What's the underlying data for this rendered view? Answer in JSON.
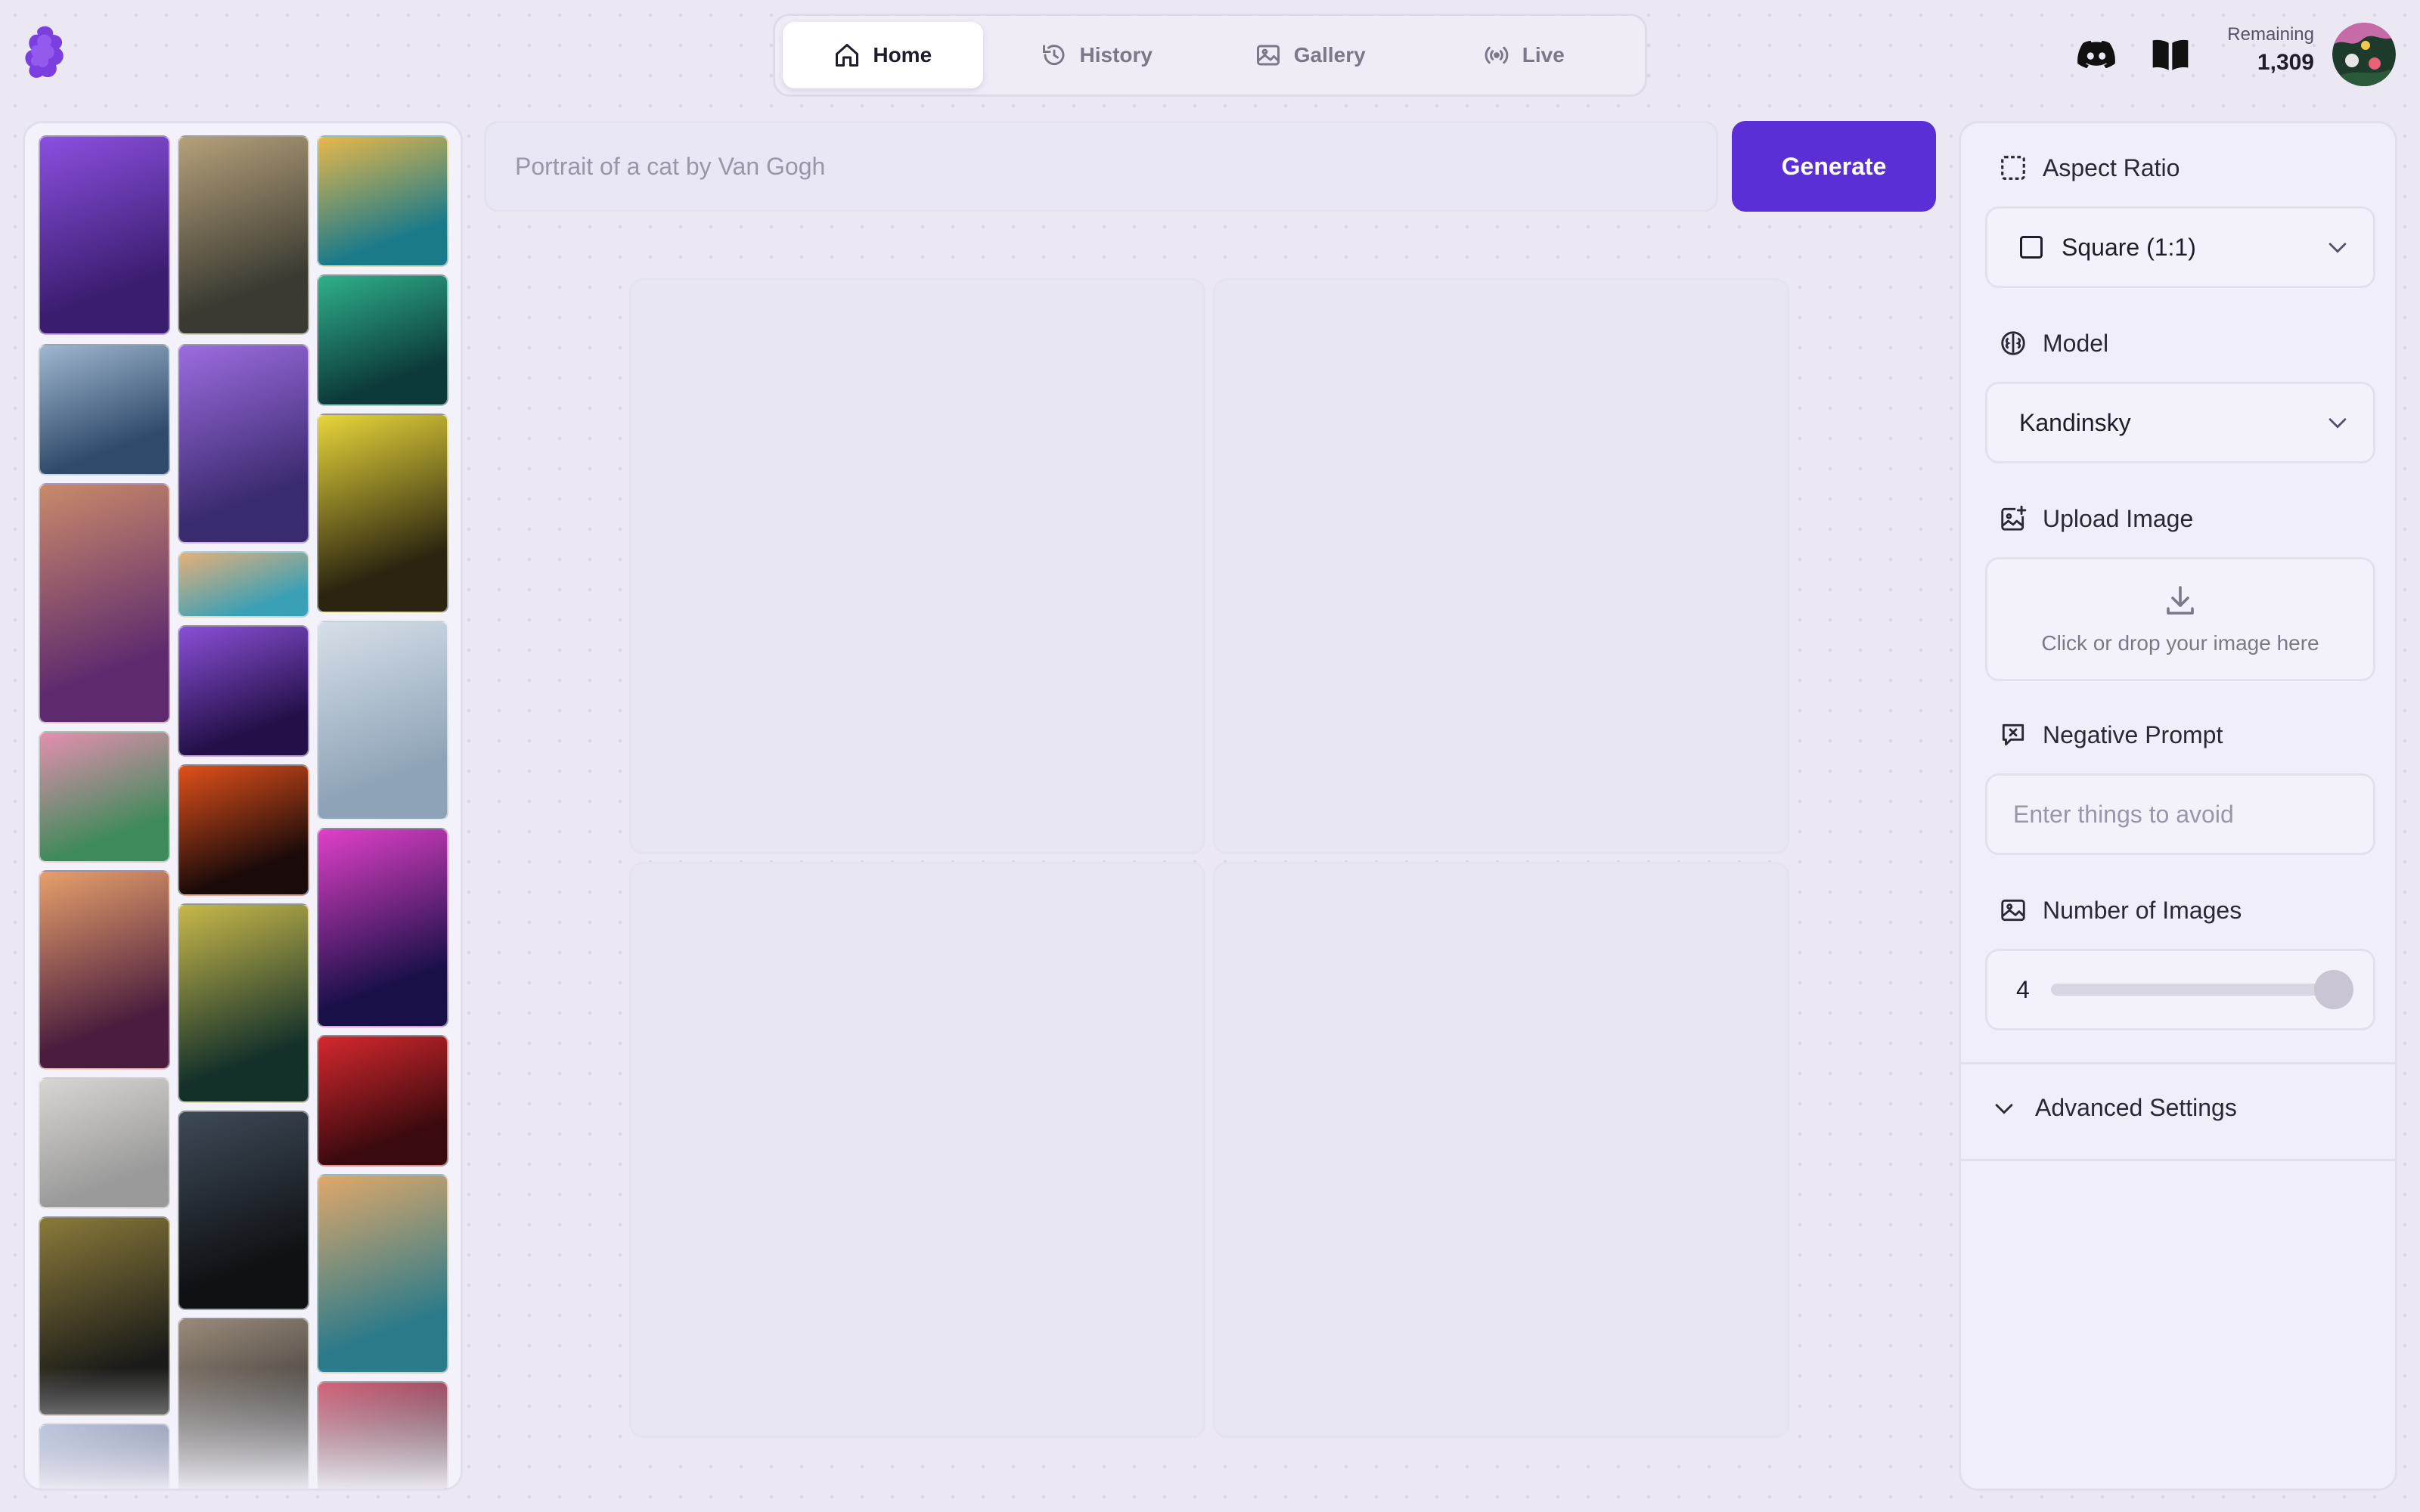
{
  "header": {
    "logo_icon": "purple-blob-logo-icon",
    "tabs": [
      {
        "label": "Home",
        "icon": "home-icon",
        "active": true
      },
      {
        "label": "History",
        "icon": "history-icon",
        "active": false
      },
      {
        "label": "Gallery",
        "icon": "image-icon",
        "active": false
      },
      {
        "label": "Live",
        "icon": "broadcast-icon",
        "active": false
      }
    ],
    "remaining_label": "Remaining",
    "remaining_value": "1,309",
    "discord_icon": "discord-icon",
    "docs_icon": "book-icon"
  },
  "gallery": {
    "columns": [
      [
        {
          "name": "purple-cat-thumbnail",
          "c1": "#3a1d6e",
          "c2": "#8b4fe0"
        },
        {
          "name": "gothic-city-thumbnail",
          "c1": "#2f4a6a",
          "c2": "#9fb6cf"
        },
        {
          "name": "anime-boy-thumbnail",
          "c1": "#5e2a6e",
          "c2": "#c98a6a"
        },
        {
          "name": "pink-flowers-thumbnail",
          "c1": "#3f8a5a",
          "c2": "#e58fb0"
        },
        {
          "name": "butterfly-crown-thumbnail",
          "c1": "#4a1d3e",
          "c2": "#e7a06b"
        },
        {
          "name": "pagoda-thumbnail",
          "c1": "#9a9a9a",
          "c2": "#d8d6d2"
        },
        {
          "name": "gold-snake-thumbnail",
          "c1": "#1a1a18",
          "c2": "#8a7a3a"
        },
        {
          "name": "blue-city-thumbnail",
          "c1": "#2c3e66",
          "c2": "#8ea3c8"
        }
      ],
      [
        {
          "name": "plague-doctors-thumbnail",
          "c1": "#3a3a32",
          "c2": "#b5a07a"
        },
        {
          "name": "raven-knight-thumbnail",
          "c1": "#3a2a6e",
          "c2": "#9c6ce0"
        },
        {
          "name": "retro-van-thumbnail",
          "c1": "#3aa0b5",
          "c2": "#e6b07a"
        },
        {
          "name": "purple-moon-forest-thumbnail",
          "c1": "#231048",
          "c2": "#8a4fd6"
        },
        {
          "name": "lava-road-thumbnail",
          "c1": "#1a0a0a",
          "c2": "#e0501a"
        },
        {
          "name": "starry-tree-thumbnail",
          "c1": "#13302a",
          "c2": "#c8b84a"
        },
        {
          "name": "black-dragon-thumbnail",
          "c1": "#0f1114",
          "c2": "#3e4a58"
        },
        {
          "name": "glasses-man-thumbnail",
          "c1": "#2a2a2a",
          "c2": "#9a8a7a"
        }
      ],
      [
        {
          "name": "surreal-face-thumbnail",
          "c1": "#1a7a8a",
          "c2": "#e8b84a"
        },
        {
          "name": "cthulhu-thumbnail",
          "c1": "#0c3a3a",
          "c2": "#2fb08a"
        },
        {
          "name": "pikachu-portrait-thumbnail",
          "c1": "#2a2410",
          "c2": "#e8d63a"
        },
        {
          "name": "raccoon-sticker-thumbnail",
          "c1": "#8fa3b8",
          "c2": "#d6dfe8"
        },
        {
          "name": "neon-crystal-thumbnail",
          "c1": "#1a1048",
          "c2": "#e040c8"
        },
        {
          "name": "red-hair-woman-thumbnail",
          "c1": "#3a0a0e",
          "c2": "#d4282e"
        },
        {
          "name": "tribal-woman-thumbnail",
          "c1": "#2a7a8a",
          "c2": "#e0a86a"
        },
        {
          "name": "red-creature-thumbnail",
          "c1": "#3a1424",
          "c2": "#d0506a"
        }
      ]
    ]
  },
  "prompt": {
    "placeholder": "Portrait of a cat by Van Gogh",
    "value": "",
    "generate_label": "Generate"
  },
  "settings": {
    "aspect_ratio": {
      "label": "Aspect Ratio",
      "value": "Square (1:1)"
    },
    "model": {
      "label": "Model",
      "value": "Kandinsky"
    },
    "upload": {
      "label": "Upload Image",
      "hint": "Click or drop your image here"
    },
    "negative_prompt": {
      "label": "Negative Prompt",
      "placeholder": "Enter things to avoid"
    },
    "num_images": {
      "label": "Number of Images",
      "value": "4",
      "fraction": 1.0
    },
    "advanced_label": "Advanced Settings"
  }
}
